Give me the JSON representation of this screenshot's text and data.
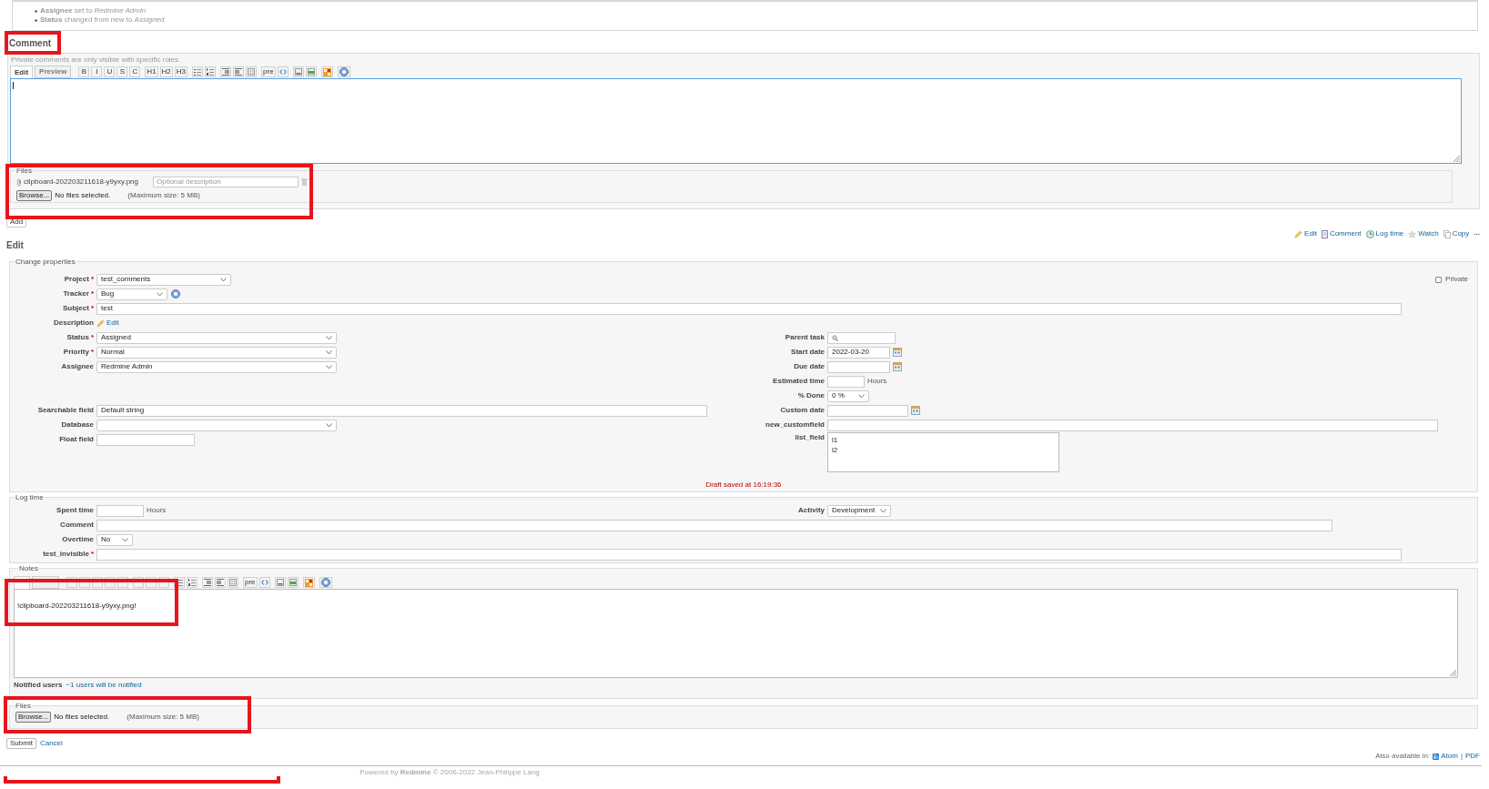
{
  "journal": {
    "details": [
      "**Assignee** set to *Redmine Admin*",
      "**Status** changed from new to *Assigned*"
    ]
  },
  "comment": {
    "heading": "Comment",
    "note": "Private comments are only visible with specific roles.",
    "tabs": [
      {
        "label": "Edit",
        "selected": true
      },
      {
        "label": "Preview",
        "selected": false
      }
    ],
    "toolbar": [
      {
        "glyph": "B"
      },
      {
        "glyph": "I"
      },
      {
        "glyph": "U"
      },
      {
        "glyph": "S"
      },
      {
        "glyph": "C"
      },
      {
        "glyph": "H1"
      },
      {
        "glyph": "H2"
      },
      {
        "glyph": "H3"
      },
      {
        "kind": "bullet-list"
      },
      {
        "kind": "numbered-list"
      },
      {
        "kind": "quote"
      },
      {
        "kind": "unquote"
      },
      {
        "kind": "table"
      },
      {
        "glyph": "pre"
      },
      {
        "kind": "code"
      },
      {
        "kind": "page"
      },
      {
        "kind": "image"
      },
      {
        "kind": "tiles"
      },
      {
        "kind": "help"
      }
    ],
    "focused": true,
    "files": {
      "legend": "Files",
      "attachments": [
        {
          "filename": "clipboard-202203211618-y9yxy.png",
          "placeholder": "Optional description"
        }
      ],
      "browse": "Browse...",
      "status": "No files selected.",
      "limit": "(Maximum size: 5 MB)"
    },
    "add_button": "Add"
  },
  "edit": {
    "actions": [
      {
        "label": "Edit",
        "kind": "pencil"
      },
      {
        "label": "Comment",
        "kind": "comment"
      },
      {
        "label": "Log time",
        "kind": "clock"
      },
      {
        "label": "Watch",
        "kind": "star"
      },
      {
        "label": "Copy",
        "kind": "copy"
      }
    ],
    "more": "...",
    "heading": "Edit",
    "change_properties": {
      "legend": "Change properties",
      "private": {
        "label": "Private",
        "checked": false
      },
      "top_fields": [
        {
          "label": "Project",
          "mark": "*",
          "kind": "select",
          "value": "test_comments"
        },
        {
          "label": "Tracker",
          "mark": "*",
          "kind": "select",
          "value": "Bug",
          "help": true
        },
        {
          "label": "Subject",
          "mark": "*",
          "kind": "text",
          "value": "test"
        },
        {
          "label": "Description",
          "kind": "link",
          "value": "Edit"
        }
      ],
      "left_fields": [
        {
          "label": "Status",
          "mark": "*",
          "kind": "select",
          "value": "Assigned"
        },
        {
          "label": "Priority",
          "mark": "*",
          "kind": "select",
          "value": "Normal"
        },
        {
          "label": "Assignee",
          "kind": "select",
          "value": "Redmine Admin"
        },
        {
          "label": "Searchable field",
          "kind": "text",
          "value": "Default string"
        },
        {
          "label": "Database",
          "kind": "select"
        },
        {
          "label": "Float field",
          "kind": "text"
        }
      ],
      "right_fields": [
        {
          "label": "Parent task",
          "kind": "search"
        },
        {
          "label": "Start date",
          "kind": "date",
          "value": "2022-03-20"
        },
        {
          "label": "Due date",
          "kind": "date"
        },
        {
          "label": "Estimated time",
          "kind": "text",
          "suffix": "Hours"
        },
        {
          "label": "% Done",
          "kind": "select",
          "value": "0 %"
        },
        {
          "label": "Custom date",
          "kind": "date"
        },
        {
          "label": "new_customfield",
          "kind": "text"
        },
        {
          "label": "list_field",
          "kind": "listbox",
          "options": [
            "l1",
            "l2"
          ]
        }
      ],
      "draft_message": "Draft saved at 16:19:36"
    },
    "log_time": {
      "legend": "Log time",
      "rows": [
        {
          "fields": [
            {
              "label": "Spent time",
              "kind": "text",
              "suffix": "Hours"
            },
            {
              "label": "Activity",
              "kind": "select",
              "value": "Development"
            }
          ]
        },
        {
          "fields": [
            {
              "label": "Comment",
              "kind": "text"
            }
          ]
        },
        {
          "fields": [
            {
              "label": "Overtime",
              "kind": "select",
              "value": "No"
            }
          ]
        },
        {
          "fields": [
            {
              "label": "test_invisible",
              "mark": "*",
              "kind": "text"
            }
          ]
        }
      ]
    },
    "notes": {
      "legend": "Notes",
      "tabs": [
        {
          "selected": true
        },
        {
          "selected": false
        }
      ],
      "toolbar": [
        {
          "kind": "blank"
        },
        {
          "kind": "blank"
        },
        {
          "kind": "blank"
        },
        {
          "kind": "blank"
        },
        {
          "kind": "blank"
        },
        {
          "kind": "blank"
        },
        {
          "kind": "blank"
        },
        {
          "kind": "blank"
        },
        {
          "kind": "bullet-list"
        },
        {
          "kind": "numbered-list"
        },
        {
          "kind": "quote"
        },
        {
          "kind": "unquote"
        },
        {
          "kind": "table"
        },
        {
          "glyph": "pre"
        },
        {
          "kind": "code"
        },
        {
          "kind": "page"
        },
        {
          "kind": "image"
        },
        {
          "kind": "tiles"
        },
        {
          "kind": "help"
        }
      ],
      "text": "!clipboard-202203211618-y9yxy.png!",
      "focused": false,
      "notified_label": "Notified users",
      "notified_link": "~1 users will be notified"
    },
    "files": {
      "legend": "Files",
      "browse": "Browse...",
      "status": "No files selected.",
      "limit": "(Maximum size: 5 MB)"
    },
    "submit": "Submit",
    "cancel": "Cancel"
  },
  "also_available": {
    "label": "Also available in:",
    "links": [
      {
        "label": "Atom",
        "kind": "feed"
      },
      {
        "label": "PDF"
      }
    ],
    "separator": "|"
  },
  "footer": "Powered by **Redmine** © 2006-2022 Jean-Philippe Lang",
  "annotations": [
    {
      "kind": "box"
    },
    {
      "kind": "box"
    },
    {
      "kind": "box"
    },
    {
      "kind": "box"
    },
    {
      "kind": "bracket"
    }
  ]
}
